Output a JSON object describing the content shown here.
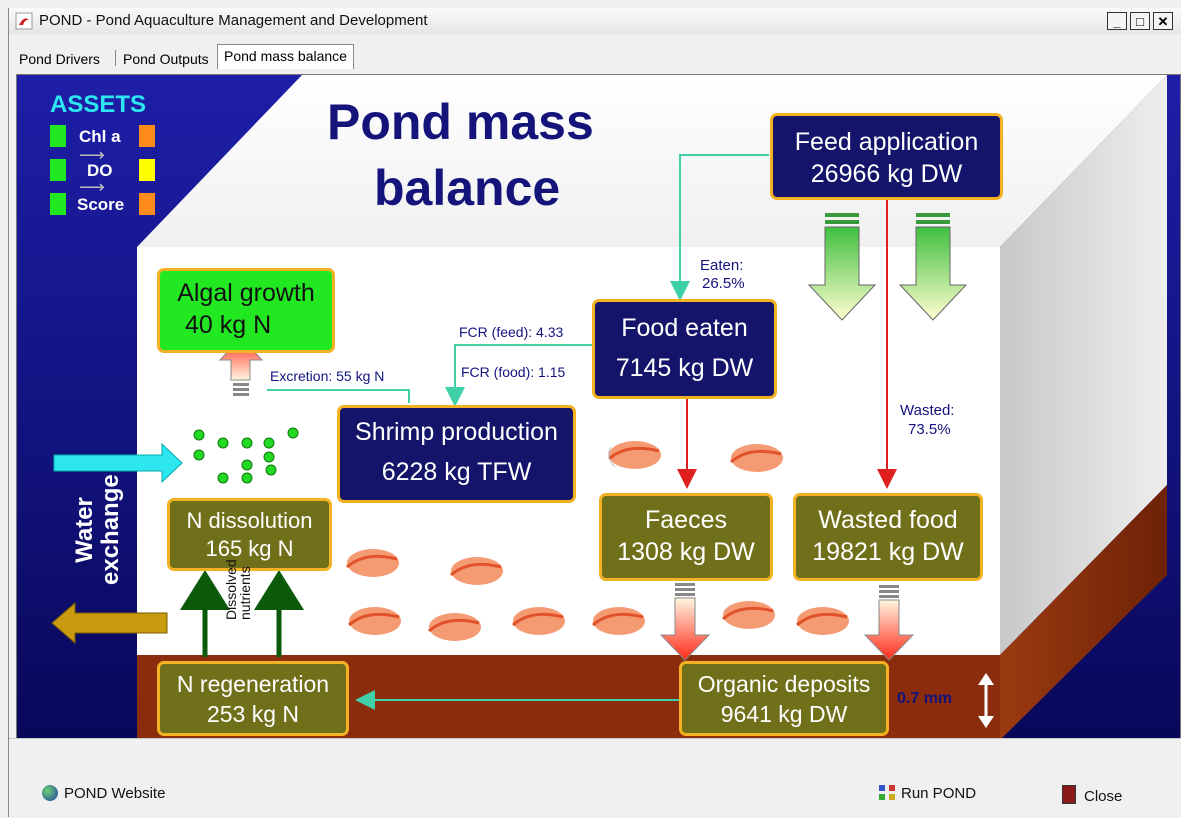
{
  "window": {
    "title": "POND - Pond Aquaculture Management and Development",
    "minimize": "_",
    "maximize": "□",
    "close": "✕"
  },
  "tabs": [
    {
      "label": "Pond Drivers",
      "active": false
    },
    {
      "label": "Pond Outputs",
      "active": false
    },
    {
      "label": "Pond mass balance",
      "active": true
    }
  ],
  "diagram": {
    "title_line1": "Pond mass",
    "title_line2": "balance",
    "assets": {
      "heading": "ASSETS",
      "rows": [
        {
          "label": "Chl a",
          "left_color": "#22e822",
          "right_color": "#ff8c1a"
        },
        {
          "label": "DO",
          "left_color": "#22e822",
          "right_color": "#ffff00"
        },
        {
          "label": "Score",
          "left_color": "#22e822",
          "right_color": "#ff8c1a"
        }
      ]
    },
    "feed_application": {
      "title": "Feed application",
      "value": "26966 kg DW"
    },
    "food_eaten": {
      "title": "Food eaten",
      "value": "7145 kg DW"
    },
    "algal_growth": {
      "title": "Algal growth",
      "value": "40 kg N"
    },
    "shrimp_production": {
      "title": "Shrimp production",
      "value": "6228 kg TFW"
    },
    "n_dissolution": {
      "title": "N dissolution",
      "value": "165 kg N"
    },
    "faeces": {
      "title": "Faeces",
      "value": "1308 kg DW"
    },
    "wasted_food": {
      "title": "Wasted food",
      "value": "19821 kg DW"
    },
    "organic_deposits": {
      "title": "Organic deposits",
      "value": "9641 kg DW"
    },
    "n_regeneration": {
      "title": "N regeneration",
      "value": "253 kg N"
    },
    "eaten_label": "Eaten:",
    "eaten_pct": "26.5%",
    "wasted_label": "Wasted:",
    "wasted_pct": "73.5%",
    "fcr_feed": "FCR (feed): 4.33",
    "fcr_food": "FCR (food): 1.15",
    "excretion": "Excretion: 55 kg N",
    "dissolved_nutrients": "Dissolved nutrients",
    "water_exchange": "Water exchange",
    "sediment_depth": "0.7 mm",
    "colors": {
      "background_navy": "#1a1aa0",
      "box_navy": "#14146a",
      "box_olive": "#71701a",
      "box_border": "#f3b224",
      "sediment": "#8b2d0c",
      "flow_teal": "#3fd0a8",
      "flow_red": "#e02020"
    }
  },
  "footer": {
    "website_label": "POND Website",
    "run_label": "Run POND",
    "close_label": "Close"
  }
}
